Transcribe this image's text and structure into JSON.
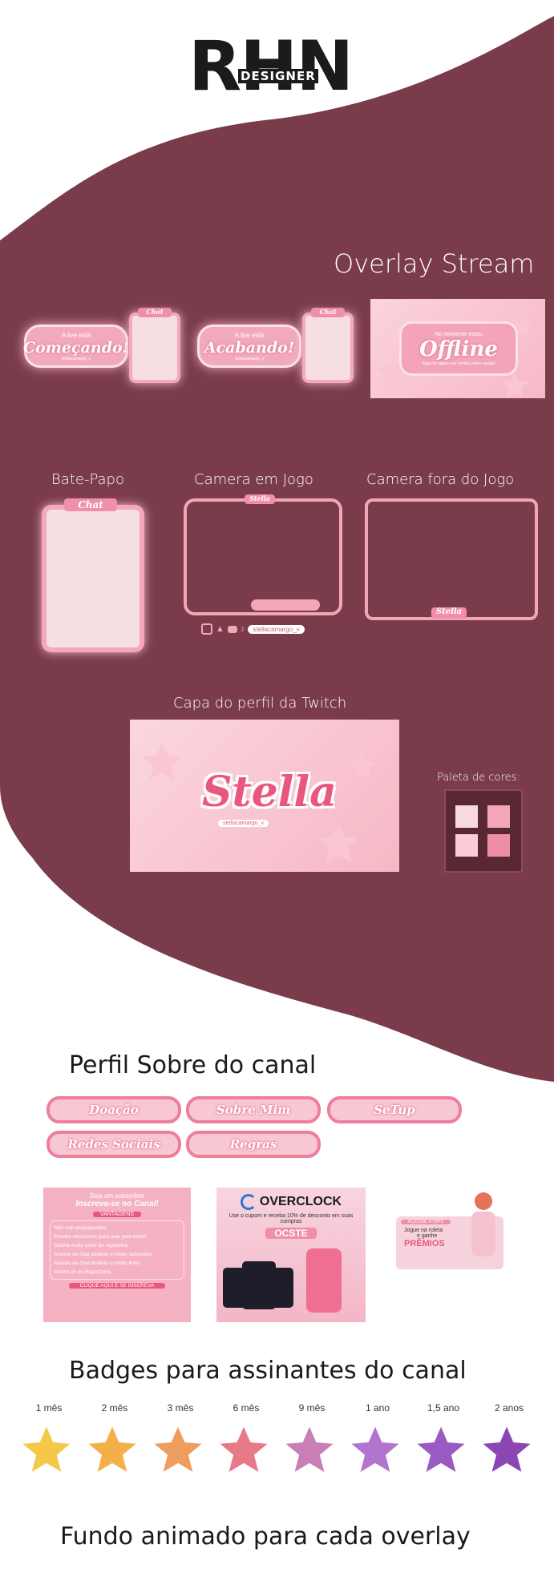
{
  "logo": {
    "main": "RHN",
    "sub": "DESIGNER"
  },
  "overlay": {
    "title": "Overlay Stream",
    "starting": {
      "small": "A live está",
      "big": "Começando!",
      "handle": "stellacamargo_v"
    },
    "ending": {
      "small": "A live está",
      "big": "Acabando!",
      "handle": "stellacamargo_v"
    },
    "chat_tag": "Chat",
    "offline": {
      "small": "No momento estou",
      "big": "Offline",
      "sub": "Siga-me ligado nas minhas redes sociais"
    }
  },
  "webcam": {
    "chat_title": "Bate-Papo",
    "chat_tag": "Chat",
    "in_game_title": "Camera em Jogo",
    "in_game_tag": "Stella",
    "in_game_handle": "stellacamargo_v",
    "out_game_title": "Camera fora do Jogo",
    "out_game_tag": "Stella"
  },
  "twitch_cover": {
    "title": "Capa do perfil da Twitch",
    "name": "Stella",
    "handle": "stellacamargo_v"
  },
  "palette": {
    "title": "Paleta de cores:",
    "colors": [
      "#f7dadf",
      "#f3a6b6",
      "#f9cdd6",
      "#ee8ea4"
    ],
    "codes": [
      "#f7dadf",
      "#f3a6b6",
      "#f9cdd6",
      "#ee8ea4"
    ]
  },
  "about": {
    "title": "Perfil Sobre do canal",
    "buttons": [
      "Doação",
      "Sobre Mim",
      "SeTup",
      "Redes Sociais",
      "Regras"
    ]
  },
  "subscriber_card": {
    "line1": "Seja um subscriber",
    "line2": "Inscreva-se no Canal!",
    "tag": "VANTAGENS",
    "items": [
      "Não vejo propagandas",
      "Emotes exclusivos para usar pela twitch",
      "Ganha muito amor do rapoanha",
      "Acesso ao chat durante o modo subscriber",
      "Acesso ao chat durante o modo lento",
      "Ganhe 2x de RapoCoins"
    ],
    "cta": "CLIQUE AQUI E SE INSCREVA"
  },
  "overclock": {
    "brand": "OVERCLOCK",
    "text": "Use o cupom e receba 10% de desconto em suas compras",
    "code": "OCSTE"
  },
  "vips": {
    "tag": "ACESSE A VIPS",
    "line1": "Jogue na roleta",
    "line2": "e ganhe",
    "big": "PRÊMIOS"
  },
  "badges": {
    "title": "Badges para assinantes do canal",
    "items": [
      {
        "label": "1 mês",
        "color": "#f5c84a"
      },
      {
        "label": "2 mês",
        "color": "#f3b048"
      },
      {
        "label": "3 mês",
        "color": "#ef9c5f"
      },
      {
        "label": "6 mês",
        "color": "#e67a87"
      },
      {
        "label": "9 mês",
        "color": "#c97fb6"
      },
      {
        "label": "1 ano",
        "color": "#b174cf"
      },
      {
        "label": "1,5 ano",
        "color": "#9a5ac3"
      },
      {
        "label": "2 anos",
        "color": "#8a46b3"
      }
    ]
  },
  "footer_title": "Fundo animado para cada overlay",
  "colors": {
    "maroon": "#7a3b4a",
    "pink": "#f3a6b6"
  }
}
